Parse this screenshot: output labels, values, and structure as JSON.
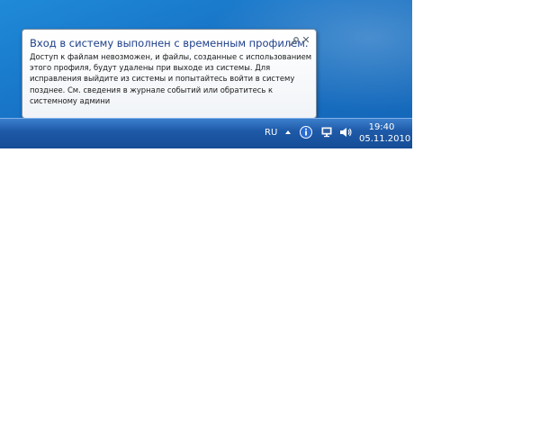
{
  "notification": {
    "title": "Вход в систему выполнен с временным профилем.",
    "body": "Доступ к файлам невозможен, и файлы, созданные с использованием этого профиля, будут удалены при выходе из системы. Для исправления выйдите из системы и попытайтесь войти в систему позднее. См. сведения в журнале событий или обратитесь к системному админи",
    "close_glyph": "✕",
    "options_icon": "wrench-icon",
    "close_icon": "close-icon"
  },
  "taskbar": {
    "language": "RU",
    "tray_icons": [
      "show-hidden-icons-arrow",
      "info-icon",
      "network-icon",
      "volume-icon"
    ],
    "clock": {
      "time": "19:40",
      "date": "05.11.2010"
    }
  },
  "colors": {
    "desktop": "#1771c4",
    "taskbar": "#1e5aa8",
    "title_text": "#1e3f8a"
  }
}
